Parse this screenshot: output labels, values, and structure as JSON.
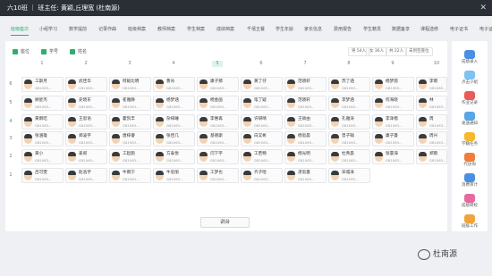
{
  "header": {
    "title": "六10班 ｜ 班主任: 黄颖,丘理宽 (杜南源)",
    "close_glyph": "✕"
  },
  "tabs": [
    "班级座次",
    "小组学习",
    "数学提前",
    "记录作曲",
    "班级档案",
    "教师档案",
    "学生档案",
    "成绩档案",
    "千禧五餐",
    "学生年龄",
    "家长信息",
    "费用报告",
    "学生籍贯",
    "数据备享",
    "课程选修",
    "电子证书",
    "电子证"
  ],
  "active_tab": 0,
  "filters": [
    "座位",
    "学号",
    "姓名"
  ],
  "stats": [
    "男 54人",
    "女 36人",
    "共 22人",
    "未到空座位"
  ],
  "columns": [
    "1",
    "2",
    "3",
    "4",
    "5",
    "6",
    "7",
    "8",
    "9",
    "10"
  ],
  "highlight_column": "5",
  "rows": [
    "6",
    "5",
    "4",
    "3",
    "2",
    "1"
  ],
  "highlight_row": "4",
  "students": [
    [
      {
        "name": "工斯月",
        "id": "G81063..."
      },
      {
        "name": "武佳华",
        "id": "G81063..."
      },
      {
        "name": "阿毅比明",
        "id": "G81063..."
      },
      {
        "name": "曹肯",
        "id": "G81063..."
      },
      {
        "name": "康子那",
        "id": "G81063..."
      },
      {
        "name": "黄丁仔",
        "id": "G81063..."
      },
      {
        "name": "范晓轩",
        "id": "G81063..."
      },
      {
        "name": "苏了涵",
        "id": "G81063..."
      },
      {
        "name": "杨梦茵",
        "id": "G81063..."
      },
      {
        "name": "李雨",
        "id": "G81063..."
      }
    ],
    [
      {
        "name": "顾星杰",
        "id": "G81063..."
      },
      {
        "name": "史晓东",
        "id": "G81063..."
      },
      {
        "name": "崔雅静",
        "id": "G81063..."
      },
      {
        "name": "杨梦涵",
        "id": "G81063..."
      },
      {
        "name": "杨金画",
        "id": "G81063..."
      },
      {
        "name": "笔丁疑",
        "id": "G81063..."
      },
      {
        "name": "范晓轩",
        "id": "G81063..."
      },
      {
        "name": "李梦涵",
        "id": "G81063..."
      },
      {
        "name": "何海晓",
        "id": "G81063..."
      },
      {
        "name": "林",
        "id": "G81063..."
      }
    ],
    [
      {
        "name": "黄雨吃",
        "id": "G81063..."
      },
      {
        "name": "王思语",
        "id": "G81063..."
      },
      {
        "name": "霍凯丰",
        "id": "G81063..."
      },
      {
        "name": "杂梓睡",
        "id": "G81063..."
      },
      {
        "name": "李惠再",
        "id": "G81063..."
      },
      {
        "name": "许研晴",
        "id": "G81063..."
      },
      {
        "name": "王硕由",
        "id": "G81063..."
      },
      {
        "name": "孔雅涛",
        "id": "G81063..."
      },
      {
        "name": "李泽楷",
        "id": "G81063..."
      },
      {
        "name": "周",
        "id": "G81063..."
      }
    ],
    [
      {
        "name": "张涵雄",
        "id": "G81063..."
      },
      {
        "name": "郑凌宇",
        "id": "G81063..."
      },
      {
        "name": "唐梓睿",
        "id": "G81063..."
      },
      {
        "name": "张佳几",
        "id": "G81063..."
      },
      {
        "name": "基德斯",
        "id": "G81063..."
      },
      {
        "name": "白又彬",
        "id": "G81063..."
      },
      {
        "name": "杨思晨",
        "id": "G81063..."
      },
      {
        "name": "曾子翰",
        "id": "G81063..."
      },
      {
        "name": "康子曼",
        "id": "G81063..."
      },
      {
        "name": "周兴",
        "id": "G81063..."
      }
    ],
    [
      {
        "name": "黄小",
        "id": "G81063..."
      },
      {
        "name": "姜闹",
        "id": "G81063..."
      },
      {
        "name": "工起跑",
        "id": "G81063..."
      },
      {
        "name": "方泰悦",
        "id": "G81063..."
      },
      {
        "name": "闫下宇",
        "id": "G81063..."
      },
      {
        "name": "工若畅",
        "id": "G81063..."
      },
      {
        "name": "杨光明",
        "id": "G81063..."
      },
      {
        "name": "杜青晨",
        "id": "G81063..."
      },
      {
        "name": "张寰海",
        "id": "G81063..."
      },
      {
        "name": "郑雨",
        "id": "G81063..."
      }
    ],
    [
      {
        "name": "吕可雯",
        "id": "G81063..."
      },
      {
        "name": "赵浩宇",
        "id": "G81063..."
      },
      {
        "name": "牛雨宁",
        "id": "G81063..."
      },
      {
        "name": "牛思丽",
        "id": "G81063..."
      },
      {
        "name": "工梦也",
        "id": "G81063..."
      },
      {
        "name": "齐子哈",
        "id": "G81063..."
      },
      {
        "name": "湛思曼",
        "id": "G81063..."
      },
      {
        "name": "宋城泽",
        "id": "G81063..."
      }
    ]
  ],
  "podium": "讲台",
  "side": [
    {
      "label": "成绩录入",
      "color": "#4a90e2"
    },
    {
      "label": "点击小组",
      "color": "#7ec2f0"
    },
    {
      "label": "作业记录",
      "color": "#ea5a5a"
    },
    {
      "label": "发送通知",
      "color": "#58a6e8"
    },
    {
      "label": "学籍任务",
      "color": "#f5b82e"
    },
    {
      "label": "代访询",
      "color": "#f07d3c"
    },
    {
      "label": "消费审计",
      "color": "#4a90e2"
    },
    {
      "label": "成绩转校",
      "color": "#e66aa0"
    },
    {
      "label": "班级工作",
      "color": "#f0a43c"
    }
  ],
  "watermark": "杜南源"
}
